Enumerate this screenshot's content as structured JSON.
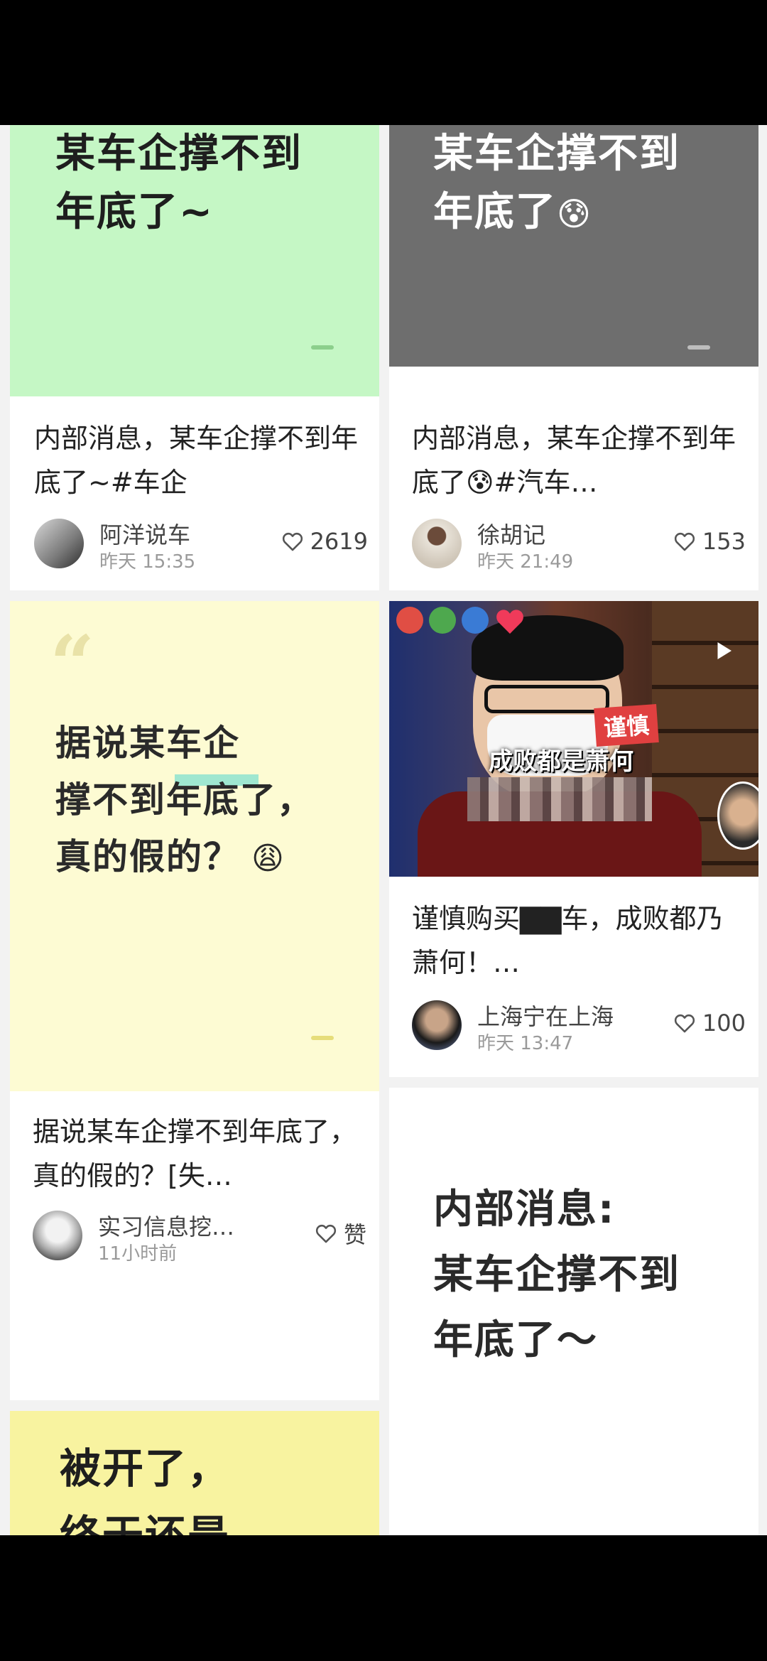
{
  "colors": {
    "cover_green": "#c5f7c5",
    "cover_gray": "#6e6e6e",
    "cover_yellow": "#fdfbd3",
    "cover_lime": "#f8f3a0",
    "accent_teal": "#7fe0cf",
    "like_gray": "#555555"
  },
  "cards": {
    "c1": {
      "cover_text": "某车企撑不到\n年底了~",
      "desc": "内部消息，某车企撑不到年底了~#车企",
      "author": "阿洋说车",
      "time": "昨天 15:35",
      "likes": "2619"
    },
    "c2": {
      "cover_text": "某车企撑不到\n年底了",
      "cover_emoji": "😰",
      "desc": "内部消息，某车企撑不到年底了😰#汽车…",
      "author": "徐胡记",
      "time": "昨天 21:49",
      "likes": "153"
    },
    "c3": {
      "quote_mark": "“",
      "cover_text": "据说某车企\n撑不到年底了，\n真的假的？",
      "cover_emoji": "😩",
      "desc": "据说某车企撑不到年底了，真的假的？[失…",
      "author": "实习信息挖…",
      "time": "11小时前",
      "likes": "赞"
    },
    "c4": {
      "video_tag": "谨慎",
      "video_caption": "成败都是萧何",
      "desc": "谨慎购买▇▇车，成败都乃萧何！…",
      "author": "上海宁在上海",
      "time": "昨天 13:47",
      "likes": "100",
      "play_icon": "play-icon"
    },
    "c5": {
      "cover_text": "被开了，\n终于还是\n撑不到年底"
    },
    "c6": {
      "cover_text": "内部消息:\n某车企撑不到\n年底了～"
    }
  }
}
